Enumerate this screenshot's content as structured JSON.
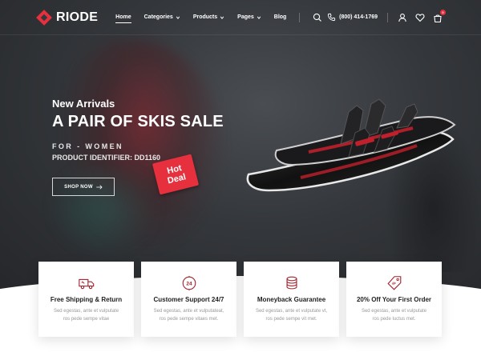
{
  "brand": {
    "name": "RIODE",
    "accent": "#e6303d"
  },
  "nav": {
    "items": [
      {
        "label": "Home",
        "has_caret": false,
        "active": true
      },
      {
        "label": "Categories",
        "has_caret": true,
        "active": false
      },
      {
        "label": "Products",
        "has_caret": true,
        "active": false
      },
      {
        "label": "Pages",
        "has_caret": true,
        "active": false
      },
      {
        "label": "Blog",
        "has_caret": false,
        "active": false
      }
    ],
    "search_icon": "search-icon"
  },
  "header_right": {
    "phone": "(800) 414-1769",
    "phone_icon": "phone-icon",
    "user_icon": "user-icon",
    "wishlist_icon": "heart-icon",
    "cart_icon": "cart-icon",
    "cart_count": "0"
  },
  "hero": {
    "subtitle": "New Arrivals",
    "title": "A PAIR OF SKIS SALE",
    "for_text": "FOR - WOMEN",
    "product_identifier": "PRODUCT IDENTIFIER: DD1160",
    "button_label": "SHOP NOW",
    "button_icon": "arrow-right-icon",
    "tag_line1": "Hot",
    "tag_line2": "Deal"
  },
  "features": [
    {
      "icon": "truck-icon",
      "title": "Free Shipping & Return",
      "desc_line1": "Sed egestas, ante et vulputate",
      "desc_line2": "ros pede sempe vitae"
    },
    {
      "icon": "support-24-icon",
      "title": "Customer Support 24/7",
      "desc_line1": "Sed egestas, ante et vulputateat,",
      "desc_line2": "ros pede sempe vitaes met."
    },
    {
      "icon": "coins-icon",
      "title": "Moneyback Guarantee",
      "desc_line1": "Sed egestas, ante et vulputate vt,",
      "desc_line2": "ros pede sempe vit met."
    },
    {
      "icon": "discount-tag-icon",
      "title": "20% Off Your First Order",
      "desc_line1": "Sed egestas, ante et vulputate",
      "desc_line2": "ros pede luctus met."
    }
  ]
}
